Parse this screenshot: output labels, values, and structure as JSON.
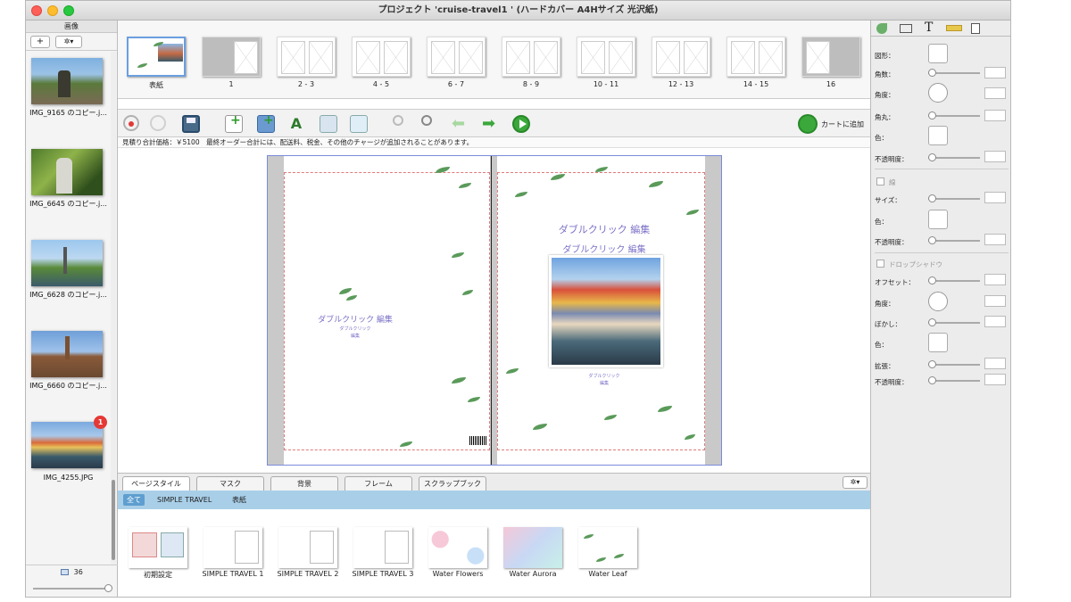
{
  "window": {
    "title": "プロジェクト 'cruise-travel1 ' (ハードカバー A4Hサイズ 光沢紙)"
  },
  "left_panel": {
    "header": "画像",
    "add_label": "+",
    "gear_label": "✲▾",
    "photos": [
      {
        "name": "IMG_9165 のコピー.j..."
      },
      {
        "name": "IMG_6645 のコピー.j..."
      },
      {
        "name": "IMG_6628 のコピー.j..."
      },
      {
        "name": "IMG_6660 のコピー.j..."
      },
      {
        "name": "IMG_4255.JPG",
        "badge": "1"
      }
    ],
    "count": "36"
  },
  "thumbnails": [
    {
      "label": "表紙"
    },
    {
      "label": "1"
    },
    {
      "label": "2 - 3"
    },
    {
      "label": "4 - 5"
    },
    {
      "label": "6 - 7"
    },
    {
      "label": "8 - 9"
    },
    {
      "label": "10 - 11"
    },
    {
      "label": "12 - 13"
    },
    {
      "label": "14 - 15"
    },
    {
      "label": "16"
    }
  ],
  "toolbar": {
    "cart_label": "カートに追加"
  },
  "info": {
    "text": "見積り合計価格：￥5100　最終オーダー合計には、配送料、税金、その他のチャージが追加されることがあります。"
  },
  "spread": {
    "left_title": "ダブルクリック 編集",
    "left_sub": "ダブルクリック",
    "left_sub2": "編集",
    "right_title1": "ダブルクリック 編集",
    "right_title2": "ダブルクリック 編集",
    "right_cap": "ダブルクリック",
    "right_cap2": "編集"
  },
  "tabs": [
    "ページスタイル",
    "マスク",
    "背景",
    "フレーム",
    "スクラップブック"
  ],
  "filters": [
    "全て",
    "SIMPLE TRAVEL",
    "表紙"
  ],
  "styles": [
    {
      "label": "初期設定"
    },
    {
      "label": "SIMPLE TRAVEL 1"
    },
    {
      "label": "SIMPLE TRAVEL 2"
    },
    {
      "label": "SIMPLE TRAVEL 3"
    },
    {
      "label": "Water Flowers"
    },
    {
      "label": "Water Aurora"
    },
    {
      "label": "Water Leaf"
    }
  ],
  "inspector": {
    "shape": "図形：",
    "corners": "角数：",
    "angle": "角度：",
    "roundness": "角丸：",
    "color": "色：",
    "opacity": "不透明度：",
    "border": "線",
    "size": "サイズ：",
    "color2": "色：",
    "opacity2": "不透明度：",
    "shadow": "ドロップシャドウ",
    "offset": "オフセット：",
    "angle2": "角度：",
    "blur": "ぼかし：",
    "color3": "色：",
    "spread": "拡張：",
    "opacity3": "不透明度："
  },
  "colors": {
    "accent": "#3a7bd5",
    "title_purple": "#7b72c7",
    "badge": "#e53935",
    "filter_bg": "#a9cfe8"
  }
}
